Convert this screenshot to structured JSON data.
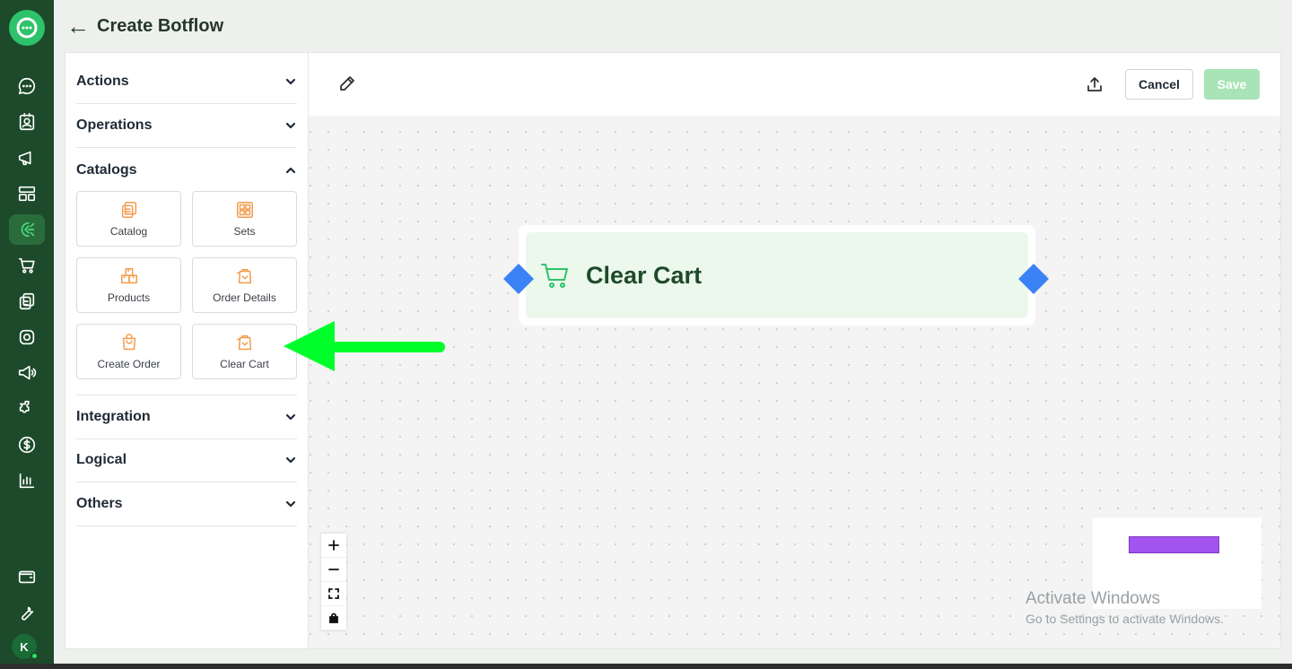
{
  "header": {
    "back_label": "←",
    "title": "Create Botflow"
  },
  "rail": {
    "avatar_initial": "K",
    "items": [
      "chat",
      "contacts",
      "broadcast",
      "templates",
      "botflow",
      "cart",
      "catalog",
      "instagram",
      "campaigns",
      "integrations",
      "payments",
      "analytics",
      "wallet",
      "settings"
    ]
  },
  "sidebar": {
    "sections": [
      {
        "label": "Actions",
        "expanded": false
      },
      {
        "label": "Operations",
        "expanded": false
      },
      {
        "label": "Catalogs",
        "expanded": true
      },
      {
        "label": "Integration",
        "expanded": false
      },
      {
        "label": "Logical",
        "expanded": false
      },
      {
        "label": "Others",
        "expanded": false
      }
    ],
    "catalog_tiles": [
      {
        "label": "Catalog",
        "icon": "catalog-icon"
      },
      {
        "label": "Sets",
        "icon": "sets-icon"
      },
      {
        "label": "Products",
        "icon": "products-icon"
      },
      {
        "label": "Order Details",
        "icon": "order-details-icon"
      },
      {
        "label": "Create Order",
        "icon": "create-order-icon"
      },
      {
        "label": "Clear Cart",
        "icon": "clear-cart-icon"
      }
    ]
  },
  "toolbar": {
    "cancel_label": "Cancel",
    "save_label": "Save"
  },
  "canvas": {
    "node": {
      "title": "Clear Cart",
      "icon": "cart-icon"
    }
  },
  "watermark": {
    "line1": "Activate Windows",
    "line2": "Go to Settings to activate Windows."
  },
  "colors": {
    "rail": "#1c4a2a",
    "accent": "#2ec26a",
    "tile_icon": "#f29b4b",
    "handle": "#3b82f6",
    "minimap_node": "#a354f0",
    "annotation_arrow": "#00ff2a",
    "save_disabled": "#a8e4b6"
  }
}
